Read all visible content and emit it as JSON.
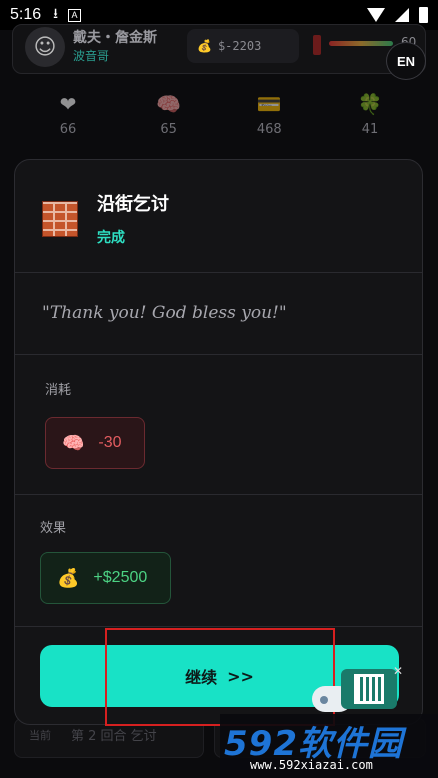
{
  "status_bar": {
    "time": "5:16",
    "download_icon": "download-icon",
    "a_icon_label": "A"
  },
  "background": {
    "player_name": "戴夫・詹金斯",
    "player_title": "波音哥",
    "money": "$-2203",
    "health": "60",
    "language_button": "EN",
    "stats": [
      {
        "icon": "heart-icon",
        "glyph": "❤",
        "value": "66"
      },
      {
        "icon": "brain-icon",
        "glyph": "🧠",
        "value": "65"
      },
      {
        "icon": "card-icon",
        "glyph": "💳",
        "value": "468"
      },
      {
        "icon": "clover-icon",
        "glyph": "🍀",
        "value": "41"
      }
    ],
    "bottom_label": "当前",
    "bottom_text": "第 2 回合 乞讨"
  },
  "modal": {
    "icon": "brick-icon",
    "title": "沿街乞讨",
    "status": "完成",
    "quote": "\"Thank you! God bless you!\"",
    "cost_label": "消耗",
    "cost_icon": "🧠",
    "cost_value": "-30",
    "effect_label": "效果",
    "effect_icon": "💰",
    "effect_value": "+$2500",
    "continue_label": "继续",
    "continue_arrow": ">>"
  },
  "watermark": {
    "main": "592软件园",
    "url": "www.592xiazai.com"
  },
  "colors": {
    "accent_teal": "#18e2c6",
    "status_green": "#2ee0c3",
    "cost_red": "#e25c60",
    "effect_green": "#4cd283"
  }
}
